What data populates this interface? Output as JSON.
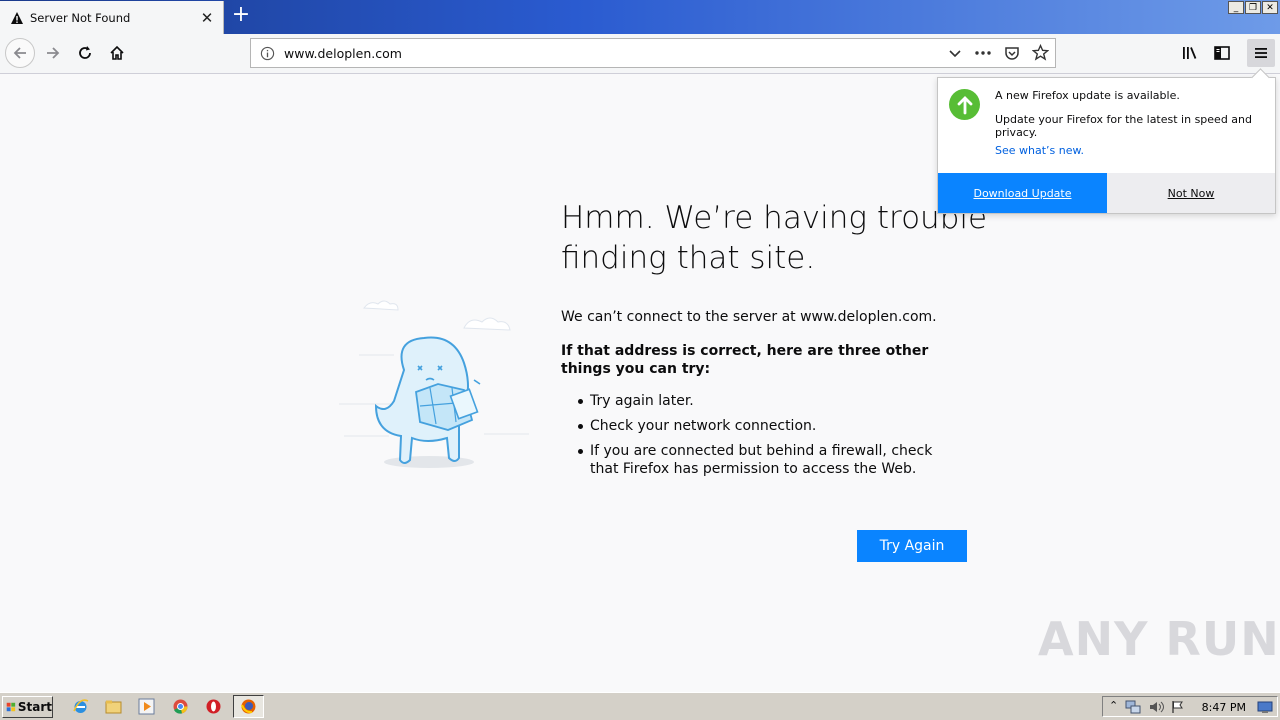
{
  "browser": {
    "tab": {
      "title": "Server Not Found",
      "close_glyph": "✕"
    },
    "new_tab_glyph": "+",
    "window_buttons": [
      "_",
      "❐",
      "✕"
    ],
    "url": "www.deloplen.com"
  },
  "error_page": {
    "title": "Hmm. We’re having trouble finding that site.",
    "description": "We can’t connect to the server at www.deloplen.com.",
    "subtitle": "If that address is correct, here are three other things you can try:",
    "suggestions": [
      "Try again later.",
      "Check your network connection.",
      "If you are connected but behind a firewall, check that Firefox has permission to access the Web."
    ],
    "try_again_label": "Try Again"
  },
  "update_panel": {
    "heading": "A new Firefox update is available.",
    "body": "Update your Firefox for the latest in speed and privacy.",
    "link": "See what’s new.",
    "download_label": "Download Update",
    "not_now_label": "Not Now",
    "accent": "#0a84ff",
    "icon_color": "#57bd35"
  },
  "watermark": {
    "text": "ANY RUN"
  },
  "taskbar": {
    "start_label": "Start",
    "clock": "8:47 PM",
    "pinned_icons": [
      "internet-explorer-icon",
      "folder-icon",
      "media-player-icon",
      "chrome-icon",
      "opera-icon",
      "firefox-icon"
    ]
  }
}
